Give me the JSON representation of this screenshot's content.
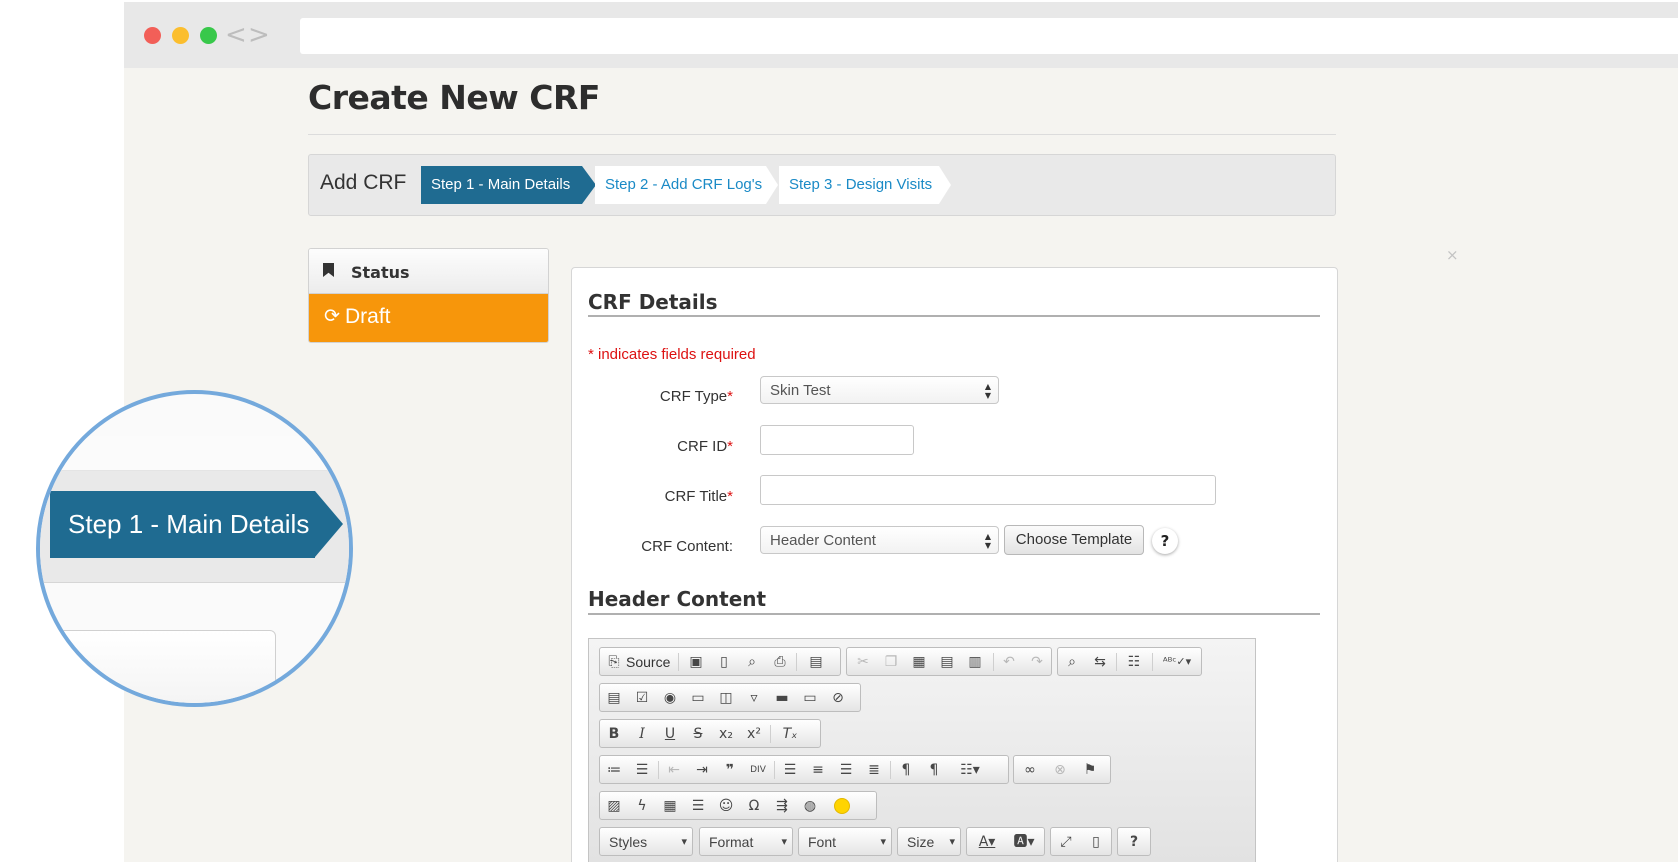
{
  "browser": {
    "nav_back": "<",
    "nav_forward": ">",
    "url": ""
  },
  "page": {
    "title": "Create New CRF"
  },
  "wizard": {
    "label": "Add CRF",
    "steps": [
      {
        "label": "Step 1 - Main Details",
        "active": true
      },
      {
        "label": "Step 2 - Add CRF Log's",
        "active": false
      },
      {
        "label": "Step 3 - Design Visits",
        "active": false
      }
    ]
  },
  "status": {
    "title": "Status",
    "value": "Draft",
    "color": "#f7960b"
  },
  "form": {
    "section_title": "CRF Details",
    "required_note": "* indicates fields required",
    "required_marker": "*",
    "fields": {
      "crf_type": {
        "label": "CRF Type",
        "value": "Skin Test"
      },
      "crf_id": {
        "label": "CRF ID",
        "value": ""
      },
      "crf_title": {
        "label": "CRF Title",
        "value": ""
      },
      "crf_content": {
        "label": "CRF Content:",
        "value": "Header Content"
      }
    },
    "choose_template_label": "Choose Template",
    "help_label": "?",
    "close_symbol": "×"
  },
  "header_content": {
    "title": "Header Content",
    "editor": {
      "source_label": "Source",
      "styles_label": "Styles",
      "format_label": "Format",
      "font_label": "Font",
      "size_label": "Size",
      "help_label": "?"
    }
  },
  "magnifier": {
    "step_label": "Step 1 - Main Details"
  },
  "colors": {
    "accent": "#1f6b91",
    "link": "#1a8ac6",
    "required": "#dd1111",
    "status_draft": "#f7960b",
    "magnifier_ring": "#74a9dc"
  }
}
